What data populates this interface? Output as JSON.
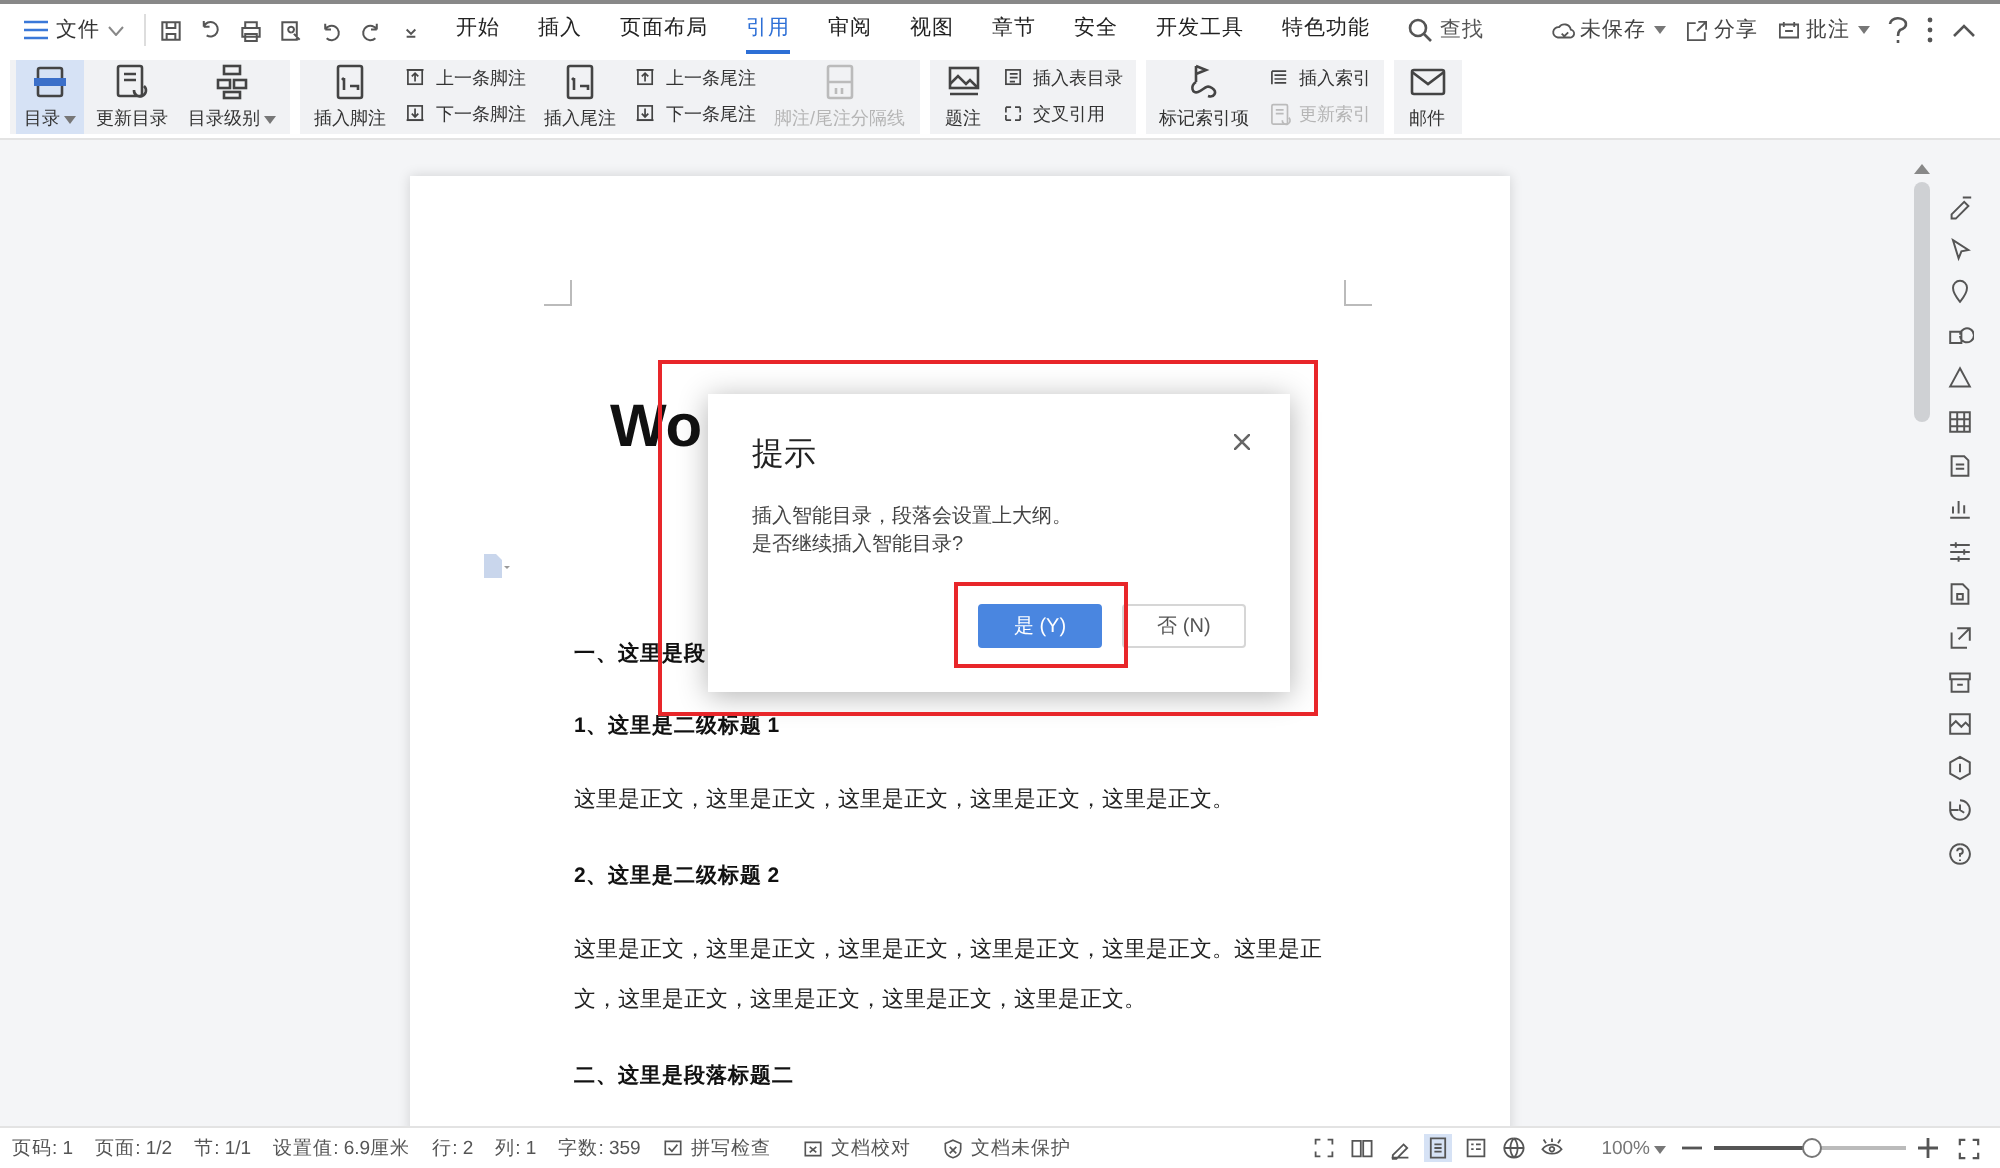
{
  "menu": {
    "file": "文件",
    "tabs": [
      {
        "label": "开始",
        "selected": false
      },
      {
        "label": "插入",
        "selected": false
      },
      {
        "label": "页面布局",
        "selected": false
      },
      {
        "label": "引用",
        "selected": true
      },
      {
        "label": "审阅",
        "selected": false
      },
      {
        "label": "视图",
        "selected": false
      },
      {
        "label": "章节",
        "selected": false
      },
      {
        "label": "安全",
        "selected": false
      },
      {
        "label": "开发工具",
        "selected": false
      },
      {
        "label": "特色功能",
        "selected": false
      }
    ],
    "search": "查找",
    "actions": [
      {
        "kind": "cloud",
        "label": "未保存",
        "dropdown": true
      },
      {
        "kind": "share",
        "label": "分享",
        "dropdown": false
      },
      {
        "kind": "comment",
        "label": "批注",
        "dropdown": true
      }
    ]
  },
  "ribbon": [
    {
      "items": [
        {
          "kind": "big",
          "label": "目录",
          "dropdown": true,
          "selected": true,
          "disabled": false
        },
        {
          "kind": "big",
          "label": "更新目录",
          "dropdown": false,
          "selected": false,
          "disabled": false
        },
        {
          "kind": "big",
          "label": "目录级别",
          "dropdown": true,
          "selected": false,
          "disabled": false
        }
      ]
    },
    {
      "items": [
        {
          "kind": "big",
          "label": "插入脚注",
          "dropdown": false,
          "selected": false,
          "disabled": false
        },
        {
          "kind": "stack",
          "items": [
            {
              "label": "上一条脚注",
              "disabled": false
            },
            {
              "label": "下一条脚注",
              "disabled": false
            }
          ]
        },
        {
          "kind": "big",
          "label": "插入尾注",
          "dropdown": false,
          "selected": false,
          "disabled": false
        },
        {
          "kind": "stack",
          "items": [
            {
              "label": "上一条尾注",
              "disabled": false
            },
            {
              "label": "下一条尾注",
              "disabled": false
            }
          ]
        },
        {
          "kind": "big",
          "label": "脚注/尾注分隔线",
          "dropdown": false,
          "selected": false,
          "disabled": true
        }
      ]
    },
    {
      "items": [
        {
          "kind": "big",
          "label": "题注",
          "dropdown": false,
          "selected": false,
          "disabled": false
        },
        {
          "kind": "stack",
          "items": [
            {
              "label": "插入表目录",
              "disabled": false
            },
            {
              "label": "交叉引用",
              "disabled": false
            }
          ]
        }
      ]
    },
    {
      "items": [
        {
          "kind": "big",
          "label": "标记索引项",
          "dropdown": false,
          "selected": false,
          "disabled": false
        },
        {
          "kind": "stack",
          "items": [
            {
              "label": "插入索引",
              "disabled": false
            },
            {
              "label": "更新索引",
              "disabled": true
            }
          ]
        }
      ]
    },
    {
      "items": [
        {
          "kind": "big",
          "label": "邮件",
          "dropdown": false,
          "selected": false,
          "disabled": false
        }
      ]
    }
  ],
  "document": {
    "title": "Wo",
    "blocks": [
      {
        "kind": "heading",
        "text": "一、这里是段"
      },
      {
        "kind": "subheading",
        "text": "1、这里是二级标题 1"
      },
      {
        "kind": "body",
        "text": "这里是正文，这里是正文，这里是正文，这里是正文，这里是正文。"
      },
      {
        "kind": "subheading",
        "text": "2、这里是二级标题 2"
      },
      {
        "kind": "body",
        "text": "这里是正文，这里是正文，这里是正文，这里是正文，这里是正文。这里是正文，这里是正文，这里是正文，这里是正文，这里是正文。"
      },
      {
        "kind": "heading",
        "text": "二、这里是段落标题二"
      }
    ]
  },
  "dialog": {
    "title": "提示",
    "message": [
      "插入智能目录，段落会设置上大纲。",
      "是否继续插入智能目录?"
    ],
    "buttons": [
      {
        "label": "是 (Y)",
        "selected": true
      },
      {
        "label": "否 (N)",
        "selected": false
      }
    ]
  },
  "status_bar": {
    "items": [
      "页码: 1",
      "页面: 1/2",
      "节: 1/1",
      "设置值: 6.9厘米",
      "行: 2",
      "列: 1",
      "字数: 359"
    ],
    "tools": [
      {
        "kind": "spell",
        "label": "拼写检查"
      },
      {
        "kind": "proof",
        "label": "文档校对"
      },
      {
        "kind": "protect",
        "label": "文档未保护"
      }
    ],
    "views": [
      {
        "kind": "fullscreen",
        "selected": false
      },
      {
        "kind": "read",
        "selected": false
      },
      {
        "kind": "pen",
        "selected": false
      },
      {
        "kind": "page",
        "selected": true
      },
      {
        "kind": "outline",
        "selected": false
      },
      {
        "kind": "web",
        "selected": false
      },
      {
        "kind": "eye",
        "selected": false
      }
    ],
    "zoom": "100%",
    "zoom_slider": {
      "level": 0.51
    }
  }
}
